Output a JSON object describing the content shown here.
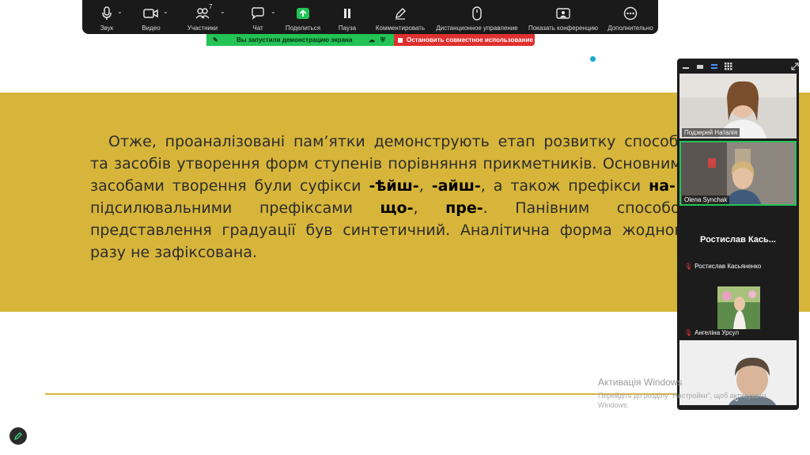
{
  "toolbar": {
    "items": [
      {
        "label": "Звук",
        "icon": "microphone-icon"
      },
      {
        "label": "Видео",
        "icon": "video-camera-icon"
      },
      {
        "label": "Участники",
        "icon": "participants-icon",
        "count": "7"
      },
      {
        "label": "Чат",
        "icon": "chat-icon"
      },
      {
        "label": "Поделиться",
        "icon": "share-screen-icon"
      },
      {
        "label": "Пауза",
        "icon": "pause-icon"
      },
      {
        "label": "Комментировать",
        "icon": "annotate-pen-icon"
      },
      {
        "label": "Дистанционное управление",
        "icon": "remote-control-mouse-icon"
      },
      {
        "label": "Показать конференцию",
        "icon": "show-meeting-icon"
      },
      {
        "label": "Дополнительно",
        "icon": "more-icon"
      }
    ]
  },
  "share_banner": {
    "status_text": "Вы запустили демонстрацию экрана",
    "stop_label": "Остановить совместное использование",
    "green": "#23c356",
    "red": "#e02f2f"
  },
  "slide": {
    "band_color": "#d7b53a",
    "p1": "Отже, проаналізовані пам’ятки демонструють етап розвитку способів та засобів утворення форм ступенів порівняння прикметників. Основними засобами творення були суфікси ",
    "b1": "-ѣйш-",
    "p2": ", ",
    "b2": "-айш-",
    "p3": ", а також префікси ",
    "b3": "на-",
    "p4": " з підсилювальними префіксами ",
    "b4": "що-",
    "p5": ", ",
    "b5": "пре-",
    "p6": ". Панівним способом представлення градуації був синтетичний. Аналітична форма жодного разу не зафіксована."
  },
  "participants": [
    {
      "name": "Подзерей Наталія",
      "type": "video"
    },
    {
      "name": "Olena Synchak",
      "type": "video",
      "active": true
    },
    {
      "name": "Ростислав  Кась...",
      "label": "Ростислав Касьяненко",
      "type": "name-only",
      "muted": true
    },
    {
      "name": "Ангеліна Урсул",
      "type": "avatar",
      "muted": true
    },
    {
      "name": "",
      "type": "video"
    }
  ],
  "watermark": {
    "title": "Активація Windows",
    "subtitle": "Перейдіть до розділу \"Настройки\", щоб активувати Windows."
  }
}
